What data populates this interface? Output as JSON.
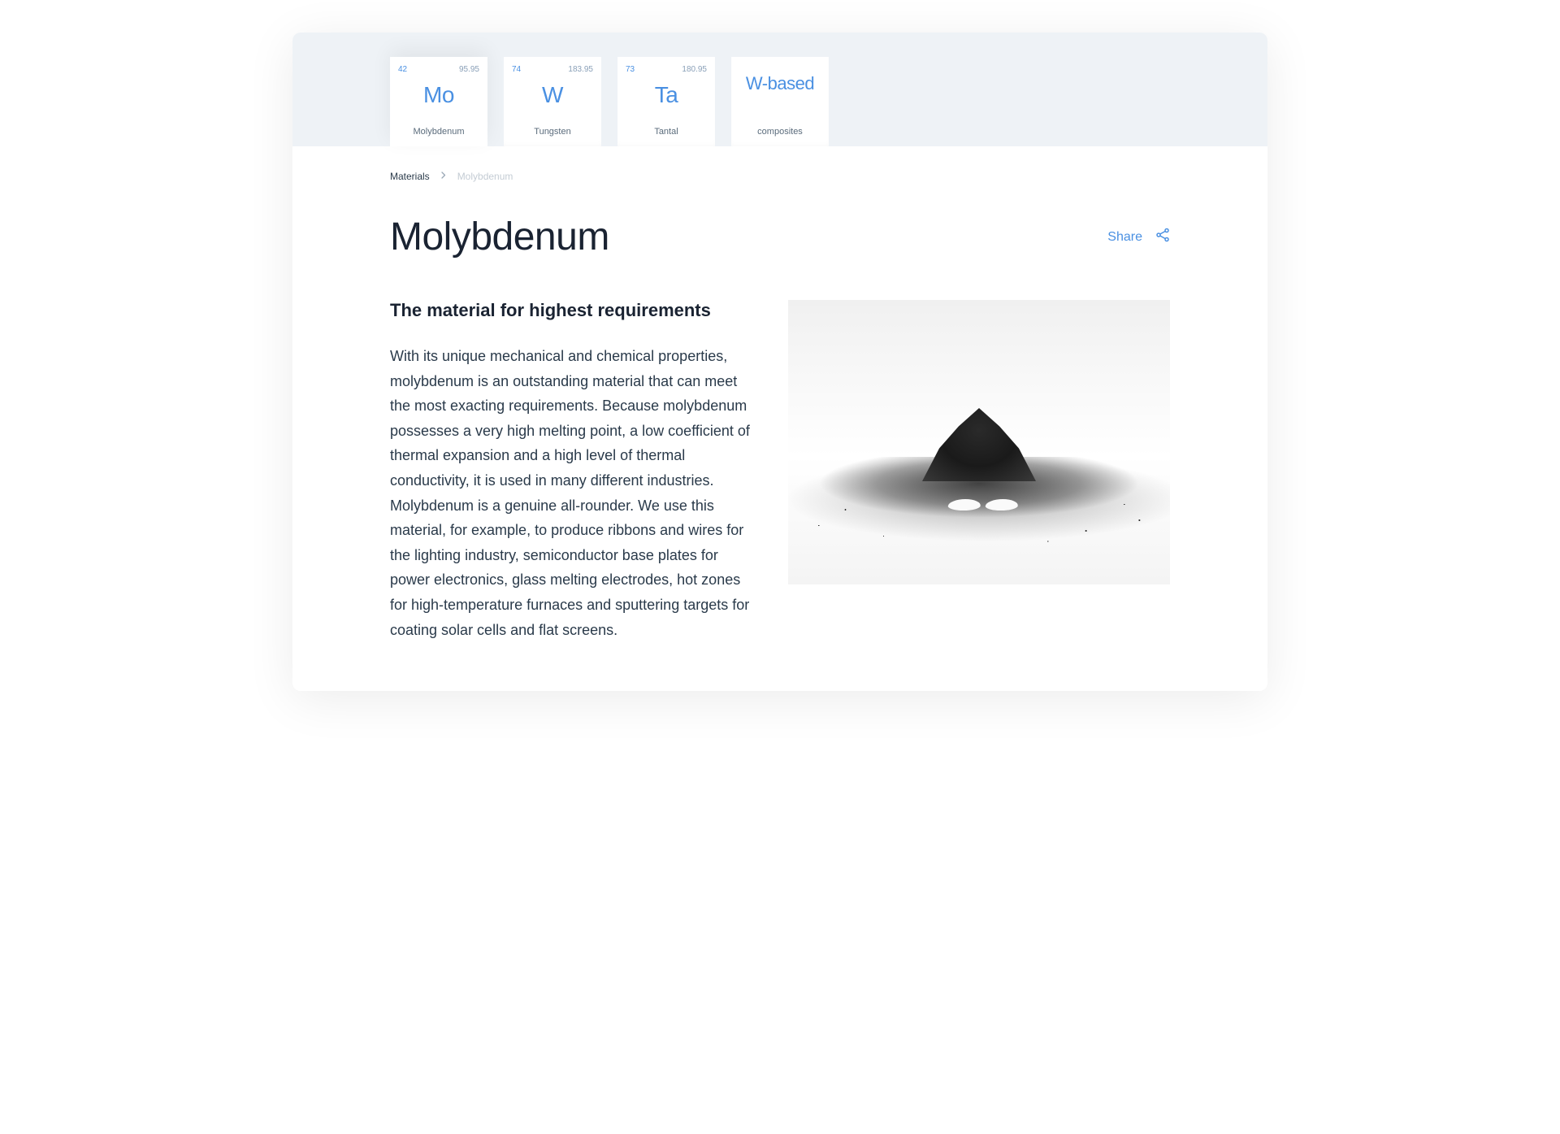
{
  "tabs": [
    {
      "atomic_number": "42",
      "mass": "95.95",
      "symbol": "Mo",
      "name": "Molybdenum",
      "active": true
    },
    {
      "atomic_number": "74",
      "mass": "183.95",
      "symbol": "W",
      "name": "Tungsten",
      "active": false
    },
    {
      "atomic_number": "73",
      "mass": "180.95",
      "symbol": "Ta",
      "name": "Tantal",
      "active": false
    },
    {
      "atomic_number": "",
      "mass": "",
      "symbol": "W-based",
      "name": "composites",
      "active": false
    }
  ],
  "breadcrumb": {
    "parent": "Materials",
    "current": "Molybdenum"
  },
  "title": "Molybdenum",
  "share_label": "Share",
  "article": {
    "subheading": "The material for highest requirements",
    "body": "With its unique mechanical and chemical properties, molybdenum is an outstanding material that can meet the most exacting requirements. Because molybdenum possesses a very high melting point, a low coefficient of thermal expansion and a high level of thermal conductivity, it is used in many different industries. Molybdenum is a genuine all-rounder. We use this material, for example, to produce ribbons and wires for the lighting industry, semiconductor base plates for power electronics, glass melting electrodes, hot zones for high-temperature furnaces and sputtering targets for coating solar cells and flat screens."
  },
  "image_alt": "molybdenum-powder-pile"
}
